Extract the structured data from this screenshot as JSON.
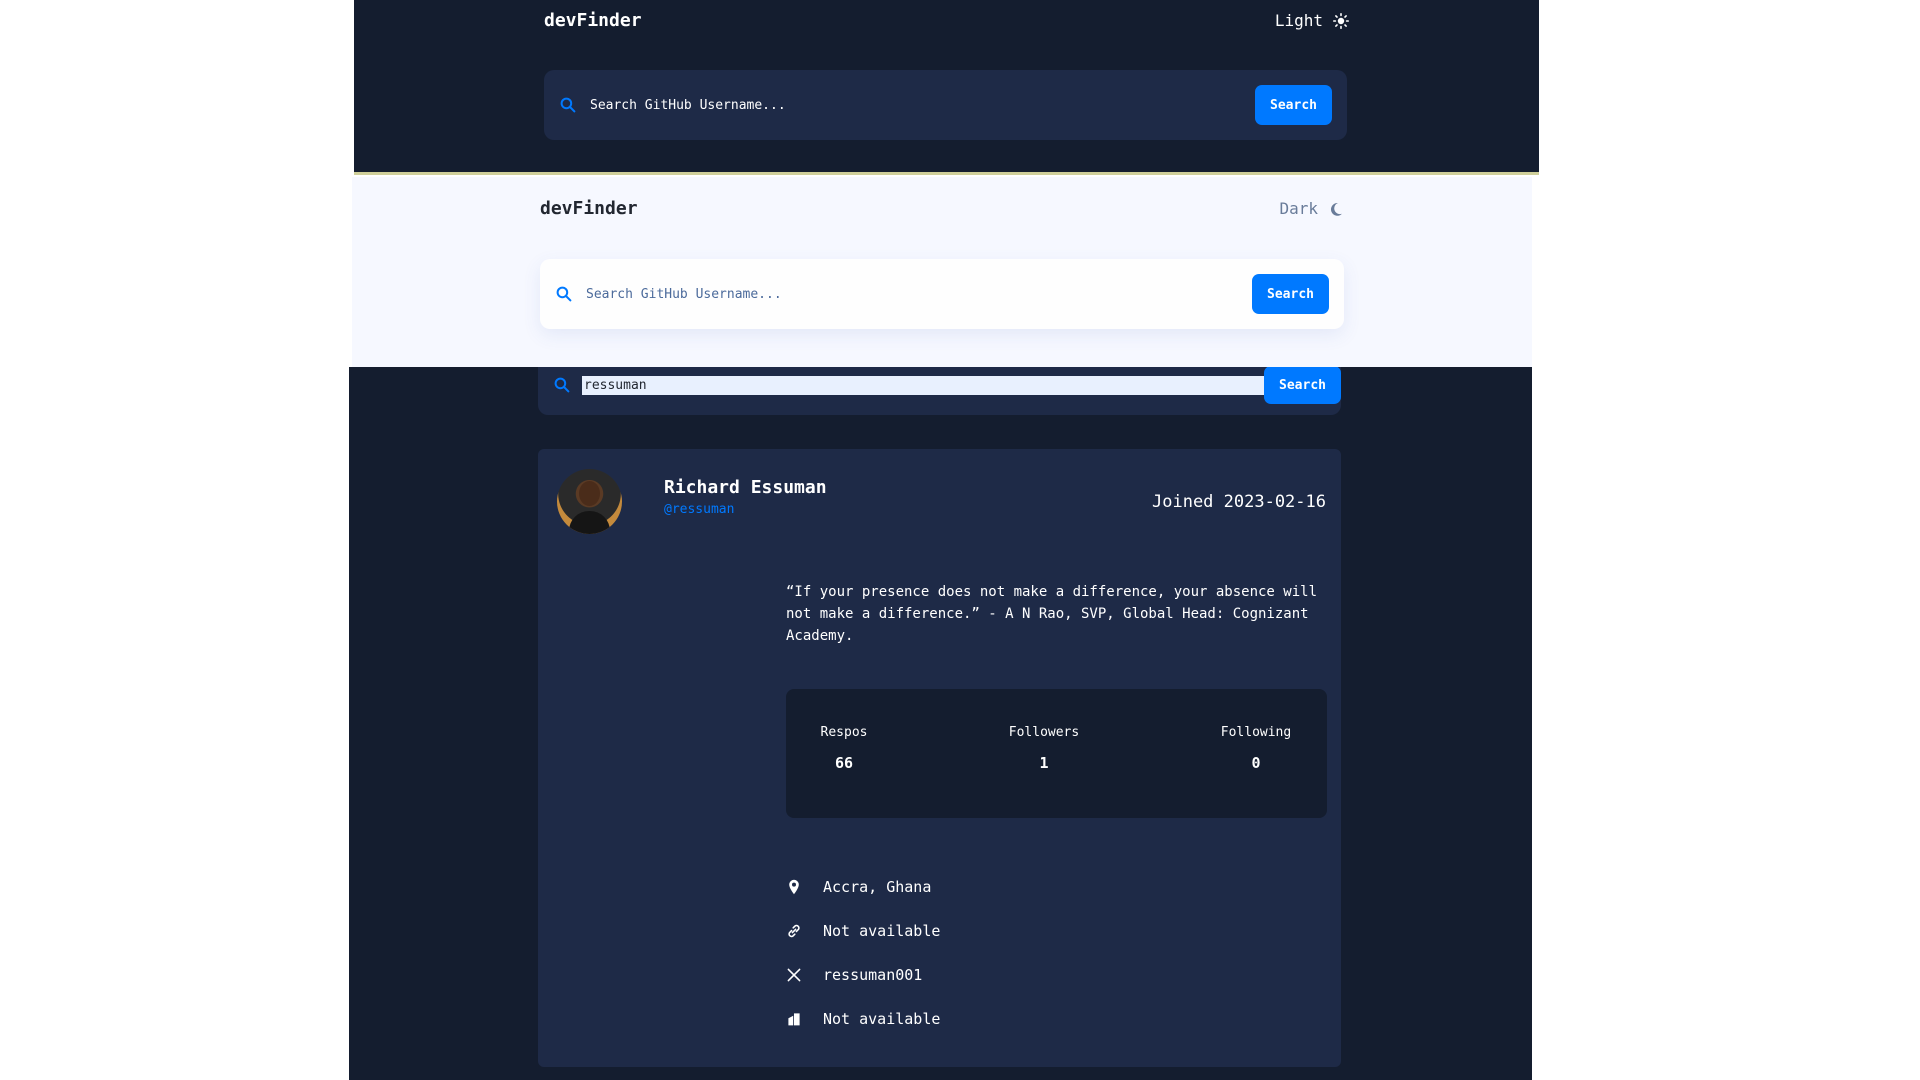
{
  "panels": {
    "dark_top": {
      "logo": "devFinder",
      "theme_label": "Light",
      "theme_icon": "sun-icon",
      "search_placeholder": "Search GitHub Username...",
      "search_button": "Search"
    },
    "light": {
      "logo": "devFinder",
      "theme_label": "Dark",
      "theme_icon": "moon-icon",
      "search_placeholder": "Search GitHub Username...",
      "search_button": "Search"
    },
    "dark_profile": {
      "search_value": "ressuman",
      "search_button": "Search",
      "profile": {
        "name": "Richard Essuman",
        "login": "@ressuman",
        "joined": "Joined 2023-02-16",
        "bio": "“If your presence does not make a difference, your absence will not make a difference.” - A N Rao, SVP, Global Head: Cognizant Academy.",
        "stats": {
          "repos_label": "Respos",
          "repos": "66",
          "followers_label": "Followers",
          "followers": "1",
          "following_label": "Following",
          "following": "0"
        },
        "links": {
          "location": "Accra, Ghana",
          "website": "Not available",
          "twitter": "ressuman001",
          "company": "Not available"
        }
      }
    }
  },
  "colors": {
    "accent": "#0079ff",
    "dark_bg": "#141d2f",
    "dark_card": "#1e2a47",
    "light_bg": "#f6f8ff"
  }
}
